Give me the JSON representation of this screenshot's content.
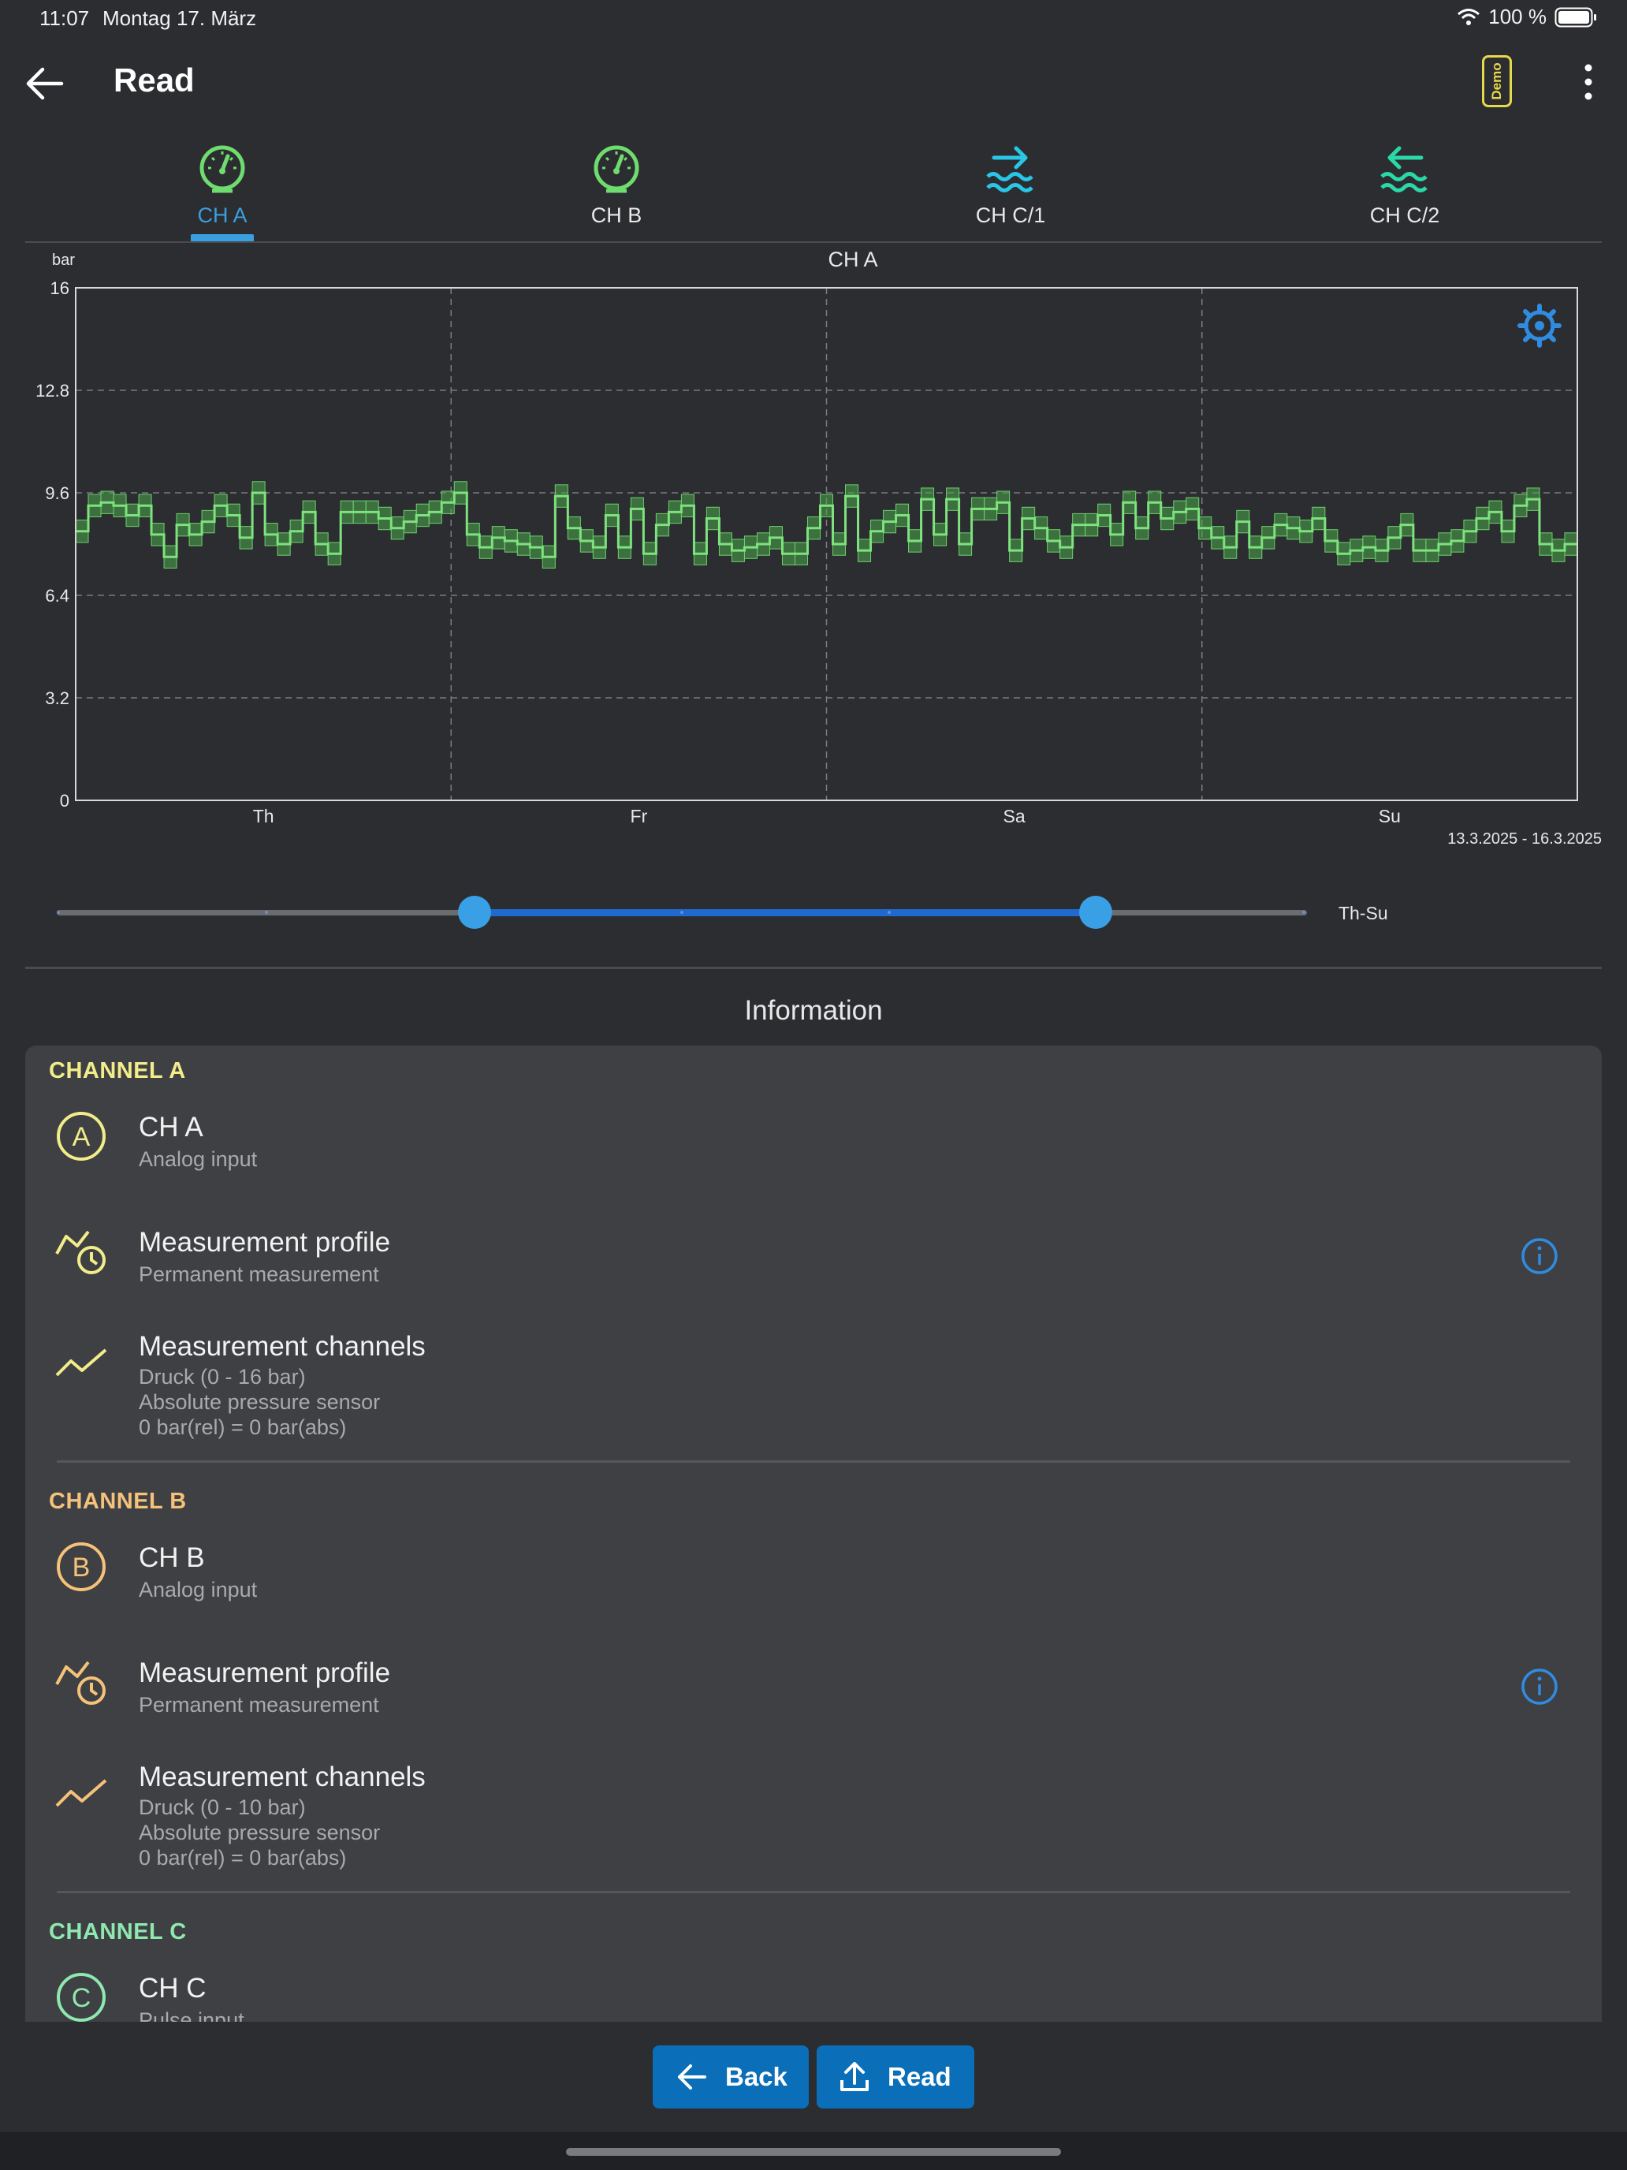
{
  "status_bar": {
    "time": "11:07",
    "date": "Montag 17. März",
    "battery": "100 %"
  },
  "app_bar": {
    "title": "Read",
    "demo_badge": "Demo",
    "back_icon": "arrow-left-icon",
    "menu_icon": "more-vert-icon"
  },
  "tabs": [
    {
      "label": "CH A",
      "icon": "gauge-icon",
      "color": "#6fdc6f",
      "active": true
    },
    {
      "label": "CH B",
      "icon": "gauge-icon",
      "color": "#6fdc6f",
      "active": false
    },
    {
      "label": "CH C/1",
      "icon": "water-in-icon",
      "color": "#29c6e8",
      "active": false
    },
    {
      "label": "CH C/2",
      "icon": "water-out-icon",
      "color": "#2ad8a8",
      "active": false
    }
  ],
  "chart_data": {
    "type": "line",
    "title": "CH A",
    "unit": "bar",
    "ylim": [
      0,
      16
    ],
    "yticks": [
      "0",
      "3.2",
      "6.4",
      "9.6",
      "12.8",
      "16"
    ],
    "xticks": [
      "Th",
      "Fr",
      "Sa",
      "Su"
    ],
    "date_range": "13.3.2025 - 16.3.2025",
    "grid": true,
    "series": [
      {
        "color": "#7ee27e",
        "band": 0.35,
        "values": [
          8.4,
          9.2,
          9.3,
          9.2,
          8.9,
          9.2,
          8.3,
          7.6,
          8.6,
          8.3,
          8.7,
          9.2,
          8.9,
          8.2,
          9.6,
          8.3,
          8.0,
          8.4,
          9.0,
          8.0,
          7.7,
          9.0,
          9.0,
          9.0,
          8.8,
          8.5,
          8.7,
          8.9,
          9.0,
          9.3,
          9.6,
          8.3,
          7.9,
          8.2,
          8.1,
          8.0,
          7.9,
          7.6,
          9.5,
          8.5,
          8.1,
          7.9,
          8.9,
          7.9,
          9.1,
          7.7,
          8.6,
          9.0,
          9.2,
          7.7,
          8.8,
          8.0,
          7.8,
          7.9,
          8.0,
          8.2,
          7.7,
          7.7,
          8.5,
          9.2,
          8.0,
          9.5,
          7.8,
          8.4,
          8.7,
          8.9,
          8.1,
          9.4,
          8.3,
          9.4,
          8.0,
          9.1,
          9.1,
          9.3,
          7.8,
          8.8,
          8.5,
          8.1,
          7.9,
          8.6,
          8.6,
          8.9,
          8.3,
          9.3,
          8.5,
          9.3,
          8.8,
          9.0,
          9.1,
          8.5,
          8.2,
          7.9,
          8.7,
          7.9,
          8.2,
          8.6,
          8.5,
          8.4,
          8.8,
          8.1,
          7.7,
          7.8,
          7.9,
          7.8,
          8.2,
          8.6,
          7.8,
          7.8,
          8.0,
          8.1,
          8.4,
          8.8,
          9.0,
          8.4,
          9.2,
          9.4,
          8.0,
          7.8,
          8.0
        ]
      }
    ]
  },
  "slider": {
    "label": "Th-Su",
    "start_fraction": 0.334,
    "end_fraction": 0.831
  },
  "info": {
    "title": "Information",
    "channels": [
      {
        "header": "CHANNEL A",
        "color": "#f2ec8a",
        "name": "CH A",
        "name_sub": "Analog input",
        "profile_title": "Measurement profile",
        "profile_sub": "Permanent measurement",
        "mc_title": "Measurement channels",
        "mc_lines": [
          "Druck (0 - 16 bar)",
          "Absolute pressure sensor",
          "0 bar(rel) = 0 bar(abs)"
        ]
      },
      {
        "header": "CHANNEL B",
        "color": "#f5c27a",
        "name": "CH B",
        "name_sub": "Analog input",
        "profile_title": "Measurement profile",
        "profile_sub": "Permanent measurement",
        "mc_title": "Measurement channels",
        "mc_lines": [
          "Druck (0 - 10 bar)",
          "Absolute pressure sensor",
          "0 bar(rel) = 0 bar(abs)"
        ]
      },
      {
        "header": "CHANNEL C",
        "color": "#8ee8b0",
        "name": "CH C",
        "name_sub": "Pulse input"
      }
    ]
  },
  "buttons": {
    "back": "Back",
    "read": "Read"
  },
  "colors": {
    "accent": "#3a9fe0",
    "button": "#0a6fb8",
    "background": "#2c2d30",
    "card": "#3f4043"
  }
}
